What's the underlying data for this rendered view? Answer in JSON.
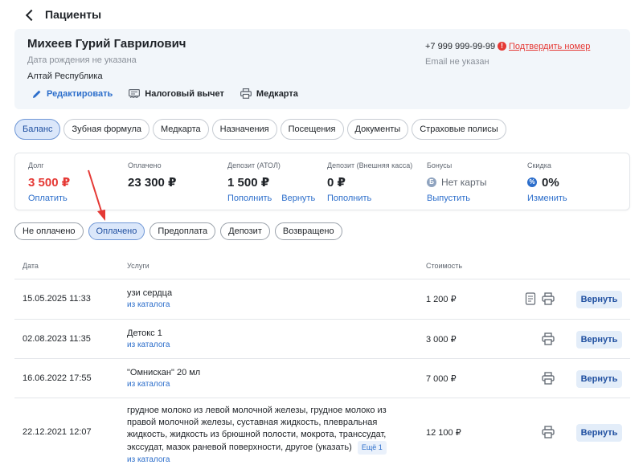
{
  "header": {
    "title": "Пациенты"
  },
  "patient": {
    "name": "Михеев Гурий Гаврилович",
    "birth_date": "Дата рождения не указана",
    "region": "Алтай Республика",
    "phone": "+7 999 999-99-99",
    "confirm_phone": "Подтвердить номер",
    "email": "Email не указан",
    "actions": {
      "edit": "Редактировать",
      "tax": "Налоговый вычет",
      "medcard": "Медкарта"
    }
  },
  "tabs": [
    {
      "label": "Баланс",
      "active": true
    },
    {
      "label": "Зубная формула"
    },
    {
      "label": "Медкарта"
    },
    {
      "label": "Назначения"
    },
    {
      "label": "Посещения"
    },
    {
      "label": "Документы"
    },
    {
      "label": "Страховые полисы"
    }
  ],
  "balance": {
    "debt": {
      "label": "Долг",
      "value": "3 500 ₽",
      "link": "Оплатить"
    },
    "paid": {
      "label": "Оплачено",
      "value": "23 300 ₽"
    },
    "deposit_atol": {
      "label": "Депозит (АТОЛ)",
      "value": "1 500 ₽",
      "link1": "Пополнить",
      "link2": "Вернуть"
    },
    "deposit_ext": {
      "label": "Депозит (Внешняя касса)",
      "value": "0 ₽",
      "link": "Пополнить"
    },
    "bonus": {
      "label": "Бонусы",
      "icon": "Б",
      "value": "Нет карты",
      "link": "Выпустить"
    },
    "discount": {
      "label": "Скидка",
      "icon": "%",
      "value": "0%",
      "link": "Изменить"
    }
  },
  "filters": [
    {
      "label": "Не оплачено"
    },
    {
      "label": "Оплачено",
      "active": true
    },
    {
      "label": "Предоплата"
    },
    {
      "label": "Депозит"
    },
    {
      "label": "Возвращено"
    }
  ],
  "table": {
    "headers": {
      "date": "Дата",
      "services": "Услуги",
      "cost": "Стоимость"
    },
    "return_label": "Вернуть",
    "rows": [
      {
        "date": "15.05.2025 11:33",
        "service": "узи сердца",
        "source": "из каталога",
        "cost": "1 200 ₽"
      },
      {
        "date": "02.08.2023 11:35",
        "service": "Детокс 1",
        "source": "из каталога",
        "cost": "3 000 ₽"
      },
      {
        "date": "16.06.2022 17:55",
        "service": "\"Омнискан\" 20 мл",
        "source": "из каталога",
        "cost": "7 000 ₽"
      },
      {
        "date": "22.12.2021 12:07",
        "service": "грудное молоко из левой молочной железы, грудное молоко из правой молочной железы, суставная жидкость, плевральная жидкость, жидкость из брюшной полости, мокрота, транссудат, экссудат, мазок раневой поверхности, другое (указать)",
        "more": "Ещё 1",
        "source": "из каталога",
        "cost": "12 100 ₽"
      }
    ]
  },
  "colors": {
    "accent": "#2c6ecb",
    "danger": "#e53935",
    "card_bg": "#f2f6fa"
  }
}
